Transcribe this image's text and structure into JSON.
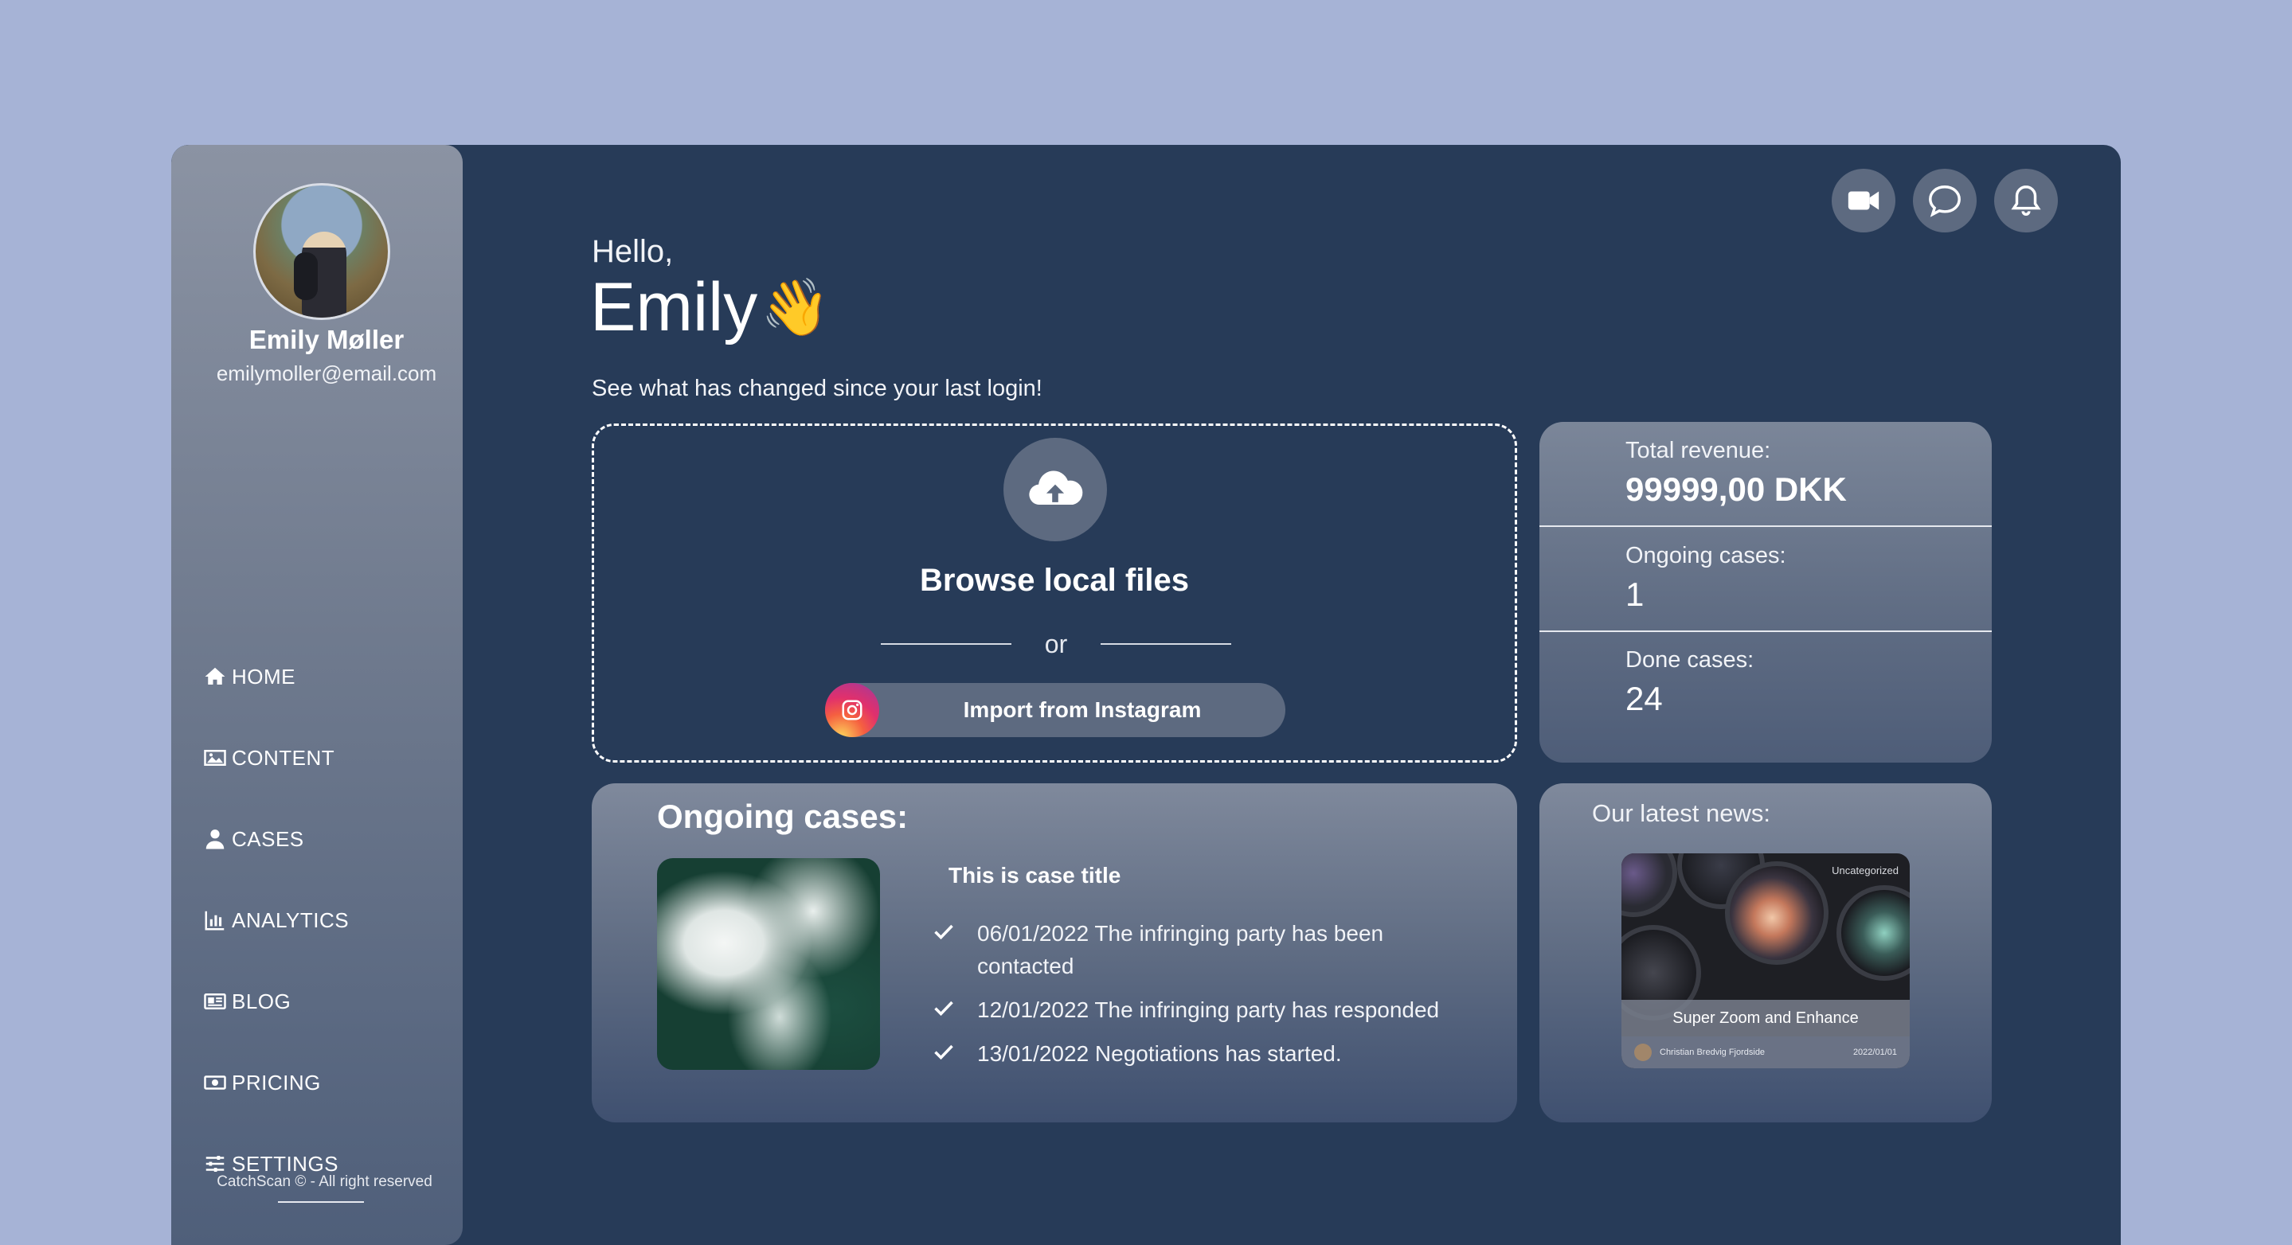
{
  "sidebar": {
    "user_name": "Emily Møller",
    "user_email": "emilymoller@email.com",
    "nav": [
      {
        "label": "HOME",
        "icon": "home-icon"
      },
      {
        "label": "CONTENT",
        "icon": "image-icon"
      },
      {
        "label": "CASES",
        "icon": "user-icon"
      },
      {
        "label": "ANALYTICS",
        "icon": "bar-chart-icon"
      },
      {
        "label": "BLOG",
        "icon": "newspaper-icon"
      },
      {
        "label": "PRICING",
        "icon": "money-icon"
      },
      {
        "label": "SETTINGS",
        "icon": "sliders-icon"
      }
    ],
    "footer": "CatchScan © - All right reserved"
  },
  "header": {
    "icons": [
      "video-camera-icon",
      "chat-bubble-icon",
      "bell-icon"
    ]
  },
  "greeting": {
    "hello": "Hello,",
    "name": "Emily",
    "emoji": "👋",
    "subtitle": "See what has changed since your last login!"
  },
  "upload": {
    "browse_label": "Browse local files",
    "or_label": "or",
    "instagram_label": "Import from Instagram"
  },
  "stats": {
    "revenue_label": "Total revenue:",
    "revenue_value": "99999,00 DKK",
    "ongoing_label": "Ongoing cases:",
    "ongoing_value": "1",
    "done_label": "Done cases:",
    "done_value": "24"
  },
  "cases": {
    "title": "Ongoing cases:",
    "case_title": "This is case title",
    "events": [
      "06/01/2022 The infringing party has been contacted",
      "12/01/2022 The infringing party has responded",
      "13/01/2022 Negotiations has started."
    ]
  },
  "news": {
    "title": "Our latest news:",
    "badge": "Uncategorized",
    "caption": "Super Zoom and Enhance",
    "author": "Christian Bredvig Fjordside",
    "date": "2022/01/01"
  },
  "colors": {
    "page_bg": "#a6b3d6",
    "app_bg": "#273b58",
    "icon_circle": "#5d6a80"
  }
}
